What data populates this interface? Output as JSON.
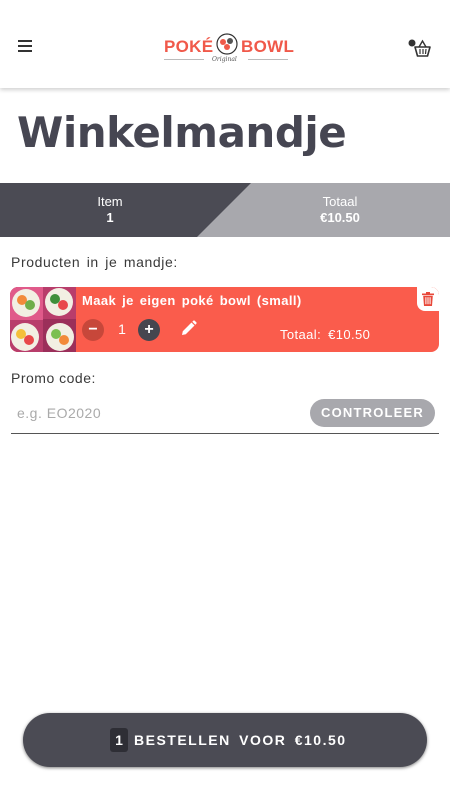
{
  "header": {
    "menu_icon": "hamburger-menu-icon",
    "logo_left": "POKÉ",
    "logo_right": "BOWL",
    "logo_sub": "Original",
    "cart_icon": "basket-icon"
  },
  "page": {
    "title": "Winkelmandje"
  },
  "summary": {
    "item_label": "Item",
    "item_value": "1",
    "total_label": "Totaal",
    "total_value": "€10.50"
  },
  "cart": {
    "section_label": "Producten in je mandje:",
    "items": [
      {
        "name": "Maak je eigen poké bowl (small)",
        "quantity": "1",
        "minus_label": "−",
        "plus_label": "+",
        "total": "Totaal: €10.50"
      }
    ]
  },
  "promo": {
    "label": "Promo code:",
    "placeholder": "e.g. EO2020",
    "value": "",
    "button_label": "CONTROLEER"
  },
  "order": {
    "count": "1",
    "label": "BESTELLEN VOOR €10.50"
  },
  "colors": {
    "accent": "#fa5c4c",
    "dark": "#4b4b54",
    "grey": "#a8a8ad"
  }
}
